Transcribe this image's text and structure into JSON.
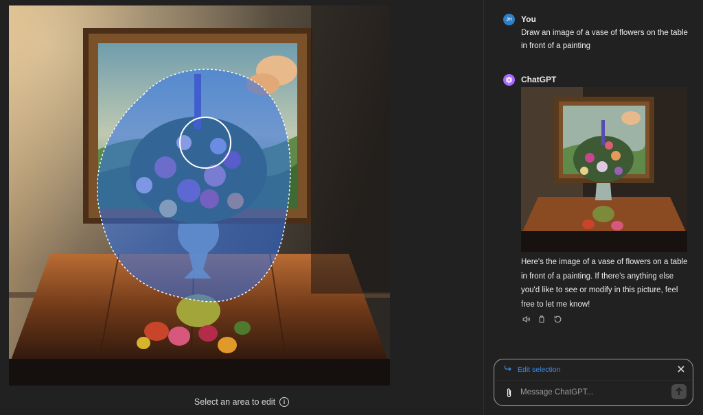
{
  "editor": {
    "hint": "Select an area to edit",
    "info_icon": "i"
  },
  "conversation": {
    "user": {
      "avatar_initials": "JH",
      "name": "You",
      "text": "Draw an image of a vase of flowers on the table in front of a painting"
    },
    "assistant": {
      "name": "ChatGPT",
      "text": "Here's the image of a vase of flowers on a table in front of a painting. If there's anything else you'd like to see or modify in this picture, feel free to let me know!",
      "actions": [
        "speaker-icon",
        "copy-icon",
        "regenerate-icon"
      ]
    }
  },
  "composer": {
    "selection_label": "Edit selection",
    "placeholder": "Message ChatGPT..."
  },
  "colors": {
    "background": "#212121",
    "accent_link": "#3d8ff0",
    "selection_overlay": "#2d6fe8",
    "chatgpt_avatar": "#ab68ff"
  }
}
